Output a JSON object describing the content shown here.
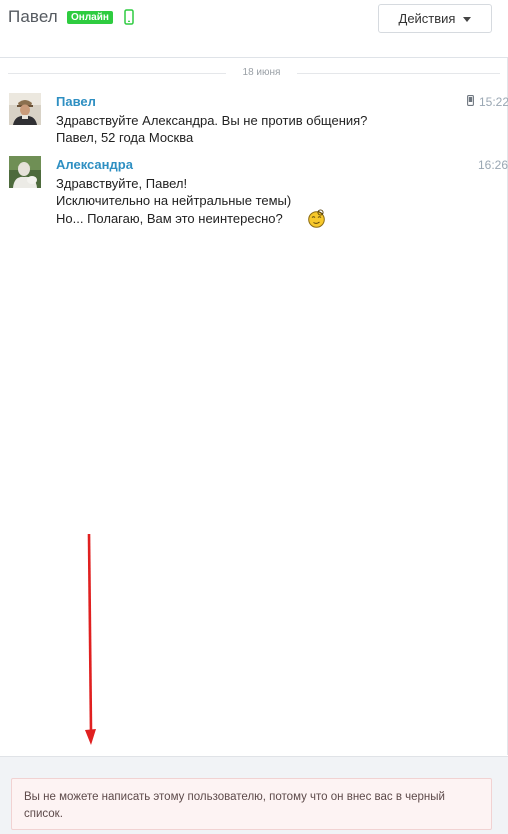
{
  "header": {
    "contact_name": "Павел",
    "status_badge": "Онлайн",
    "status_icon": "mobile-phone-icon",
    "actions_label": "Действия",
    "actions_icon": "caret-down-icon"
  },
  "chat": {
    "date_divider": "18 июня",
    "messages": [
      {
        "sender": "Павел",
        "time": "15:22",
        "device_icon": "mobile-phone-icon",
        "lines": [
          "Здравствуйте Александра. Вы не против общения?",
          "Павел, 52 года Москва"
        ]
      },
      {
        "sender": "Александра",
        "time": "16:26",
        "lines": [
          "Здравствуйте, Павел!",
          "Исключительно на нейтральные темы)",
          "Но... Полагаю, Вам это неинтересно?"
        ],
        "emoji": "thinking-smiley-icon"
      }
    ]
  },
  "footer": {
    "notice": "Вы не можете написать этому пользователю, потому что он внес вас в черный список."
  },
  "colors": {
    "online": "#2ecc40",
    "sender": "#2e8fc2",
    "annotation_arrow": "#e02020",
    "notice_bg": "#fdf3f3"
  }
}
